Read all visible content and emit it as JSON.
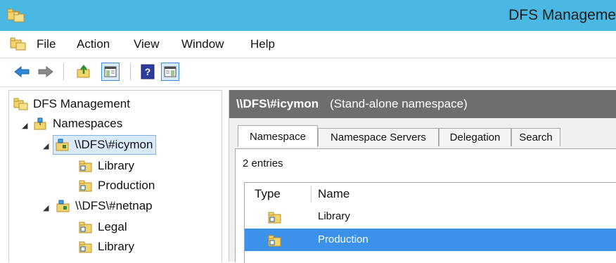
{
  "window": {
    "title": "DFS Manageme"
  },
  "menu": {
    "items": [
      "File",
      "Action",
      "View",
      "Window",
      "Help"
    ]
  },
  "toolbar": {
    "buttons": [
      "back-arrow-icon",
      "forward-arrow-icon",
      "up-folder-icon",
      "show-hide-tree-icon",
      "help-icon",
      "show-hide-action-pane-icon"
    ]
  },
  "tree": {
    "root": "DFS Management",
    "namespaces_label": "Namespaces",
    "ns1": {
      "label": "\\\\DFS\\#icymon",
      "children": [
        "Library",
        "Production"
      ]
    },
    "ns2": {
      "label": "\\\\DFS\\#netnap",
      "children": [
        "Legal",
        "Library"
      ]
    }
  },
  "details": {
    "header_name": "\\\\DFS\\#icymon",
    "header_kind": "(Stand-alone namespace)",
    "tabs": [
      "Namespace",
      "Namespace Servers",
      "Delegation",
      "Search"
    ],
    "entries_count": "2 entries",
    "columns": {
      "type": "Type",
      "name": "Name"
    },
    "rows": [
      {
        "name": "Library",
        "selected": false
      },
      {
        "name": "Production",
        "selected": true
      }
    ]
  },
  "colors": {
    "titlebar": "#49b8e3",
    "header": "#6e6e6e",
    "selection": "#3b92e8"
  }
}
